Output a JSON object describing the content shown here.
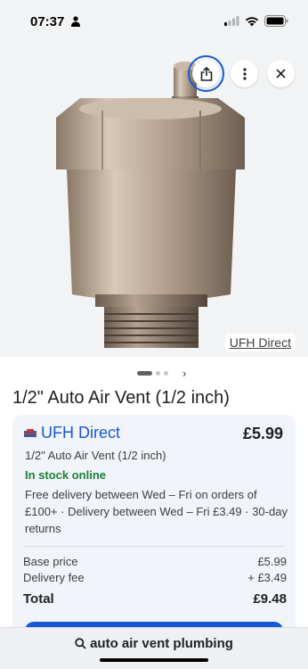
{
  "status_bar": {
    "time": "07:37"
  },
  "image": {
    "source_label": "UFH Direct",
    "icons": [
      "share-icon",
      "more-vert-icon",
      "close-icon"
    ]
  },
  "product": {
    "title": "1/2\" Auto Air Vent (1/2 inch)"
  },
  "offer": {
    "merchant": "UFH Direct",
    "price": "£5.99",
    "title": "1/2\" Auto Air Vent (1/2 inch)",
    "stock": "In stock online",
    "delivery": "Free delivery between Wed – Fri on orders of £100+ · Delivery between Wed – Fri £3.49 · 30-day returns",
    "base_price_label": "Base price",
    "base_price_value": "£5.99",
    "delivery_fee_label": "Delivery fee",
    "delivery_fee_value": "+ £3.49",
    "total_label": "Total",
    "total_value": "£9.48"
  },
  "search": {
    "query": "auto air vent plumbing"
  },
  "colors": {
    "accent": "#1a57d6",
    "stock_green": "#188038",
    "background": "#f1f3f4"
  }
}
